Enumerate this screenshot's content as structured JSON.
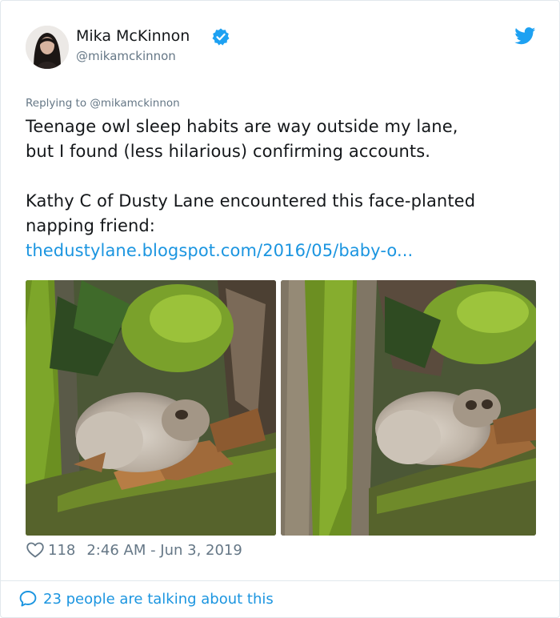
{
  "author": {
    "name": "Mika McKinnon",
    "handle": "@mikamckinnon",
    "verified": true
  },
  "reply": {
    "text": "Replying to @mikamckinnon"
  },
  "tweet": {
    "line1": "Teenage owl sleep habits are way outside my lane,",
    "line2": "but I found (less hilarious) confirming accounts.",
    "line3": "Kathy C of Dusty Lane encountered this face-planted",
    "line4": "napping friend:",
    "link": "thedustylane.blogspot.com/2016/05/baby-o..."
  },
  "stats": {
    "likes": "118",
    "timestamp": "2:46 AM - Jun 3, 2019"
  },
  "footer": {
    "talking": "23 people are talking about this"
  },
  "icons": {
    "verified": "verified-badge-icon",
    "brand": "twitter-bird-icon",
    "like": "heart-icon",
    "reply": "speech-bubble-icon"
  },
  "colors": {
    "link": "#1b95e0",
    "secondary_text": "#657786",
    "primary_text": "#14171a",
    "border": "#e1e8ed"
  }
}
